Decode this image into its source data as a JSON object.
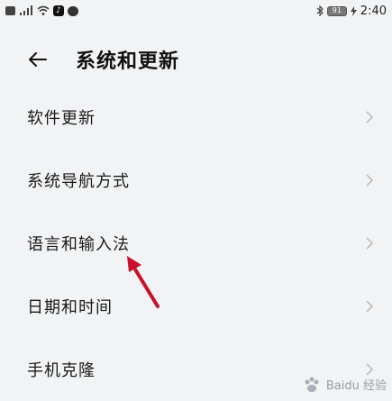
{
  "status_bar": {
    "signal_text": "⁴ᴳ",
    "battery_level": "91",
    "time": "2:40"
  },
  "header": {
    "title": "系统和更新"
  },
  "items": [
    {
      "label": "软件更新"
    },
    {
      "label": "系统导航方式"
    },
    {
      "label": "语言和输入法"
    },
    {
      "label": "日期和时间"
    },
    {
      "label": "手机克隆"
    }
  ],
  "colors": {
    "background": "#f1f3f5",
    "annotation_arrow": "#c8102e",
    "chevron": "#bdbdbd"
  },
  "watermark": {
    "text": "Baidu 经验"
  }
}
